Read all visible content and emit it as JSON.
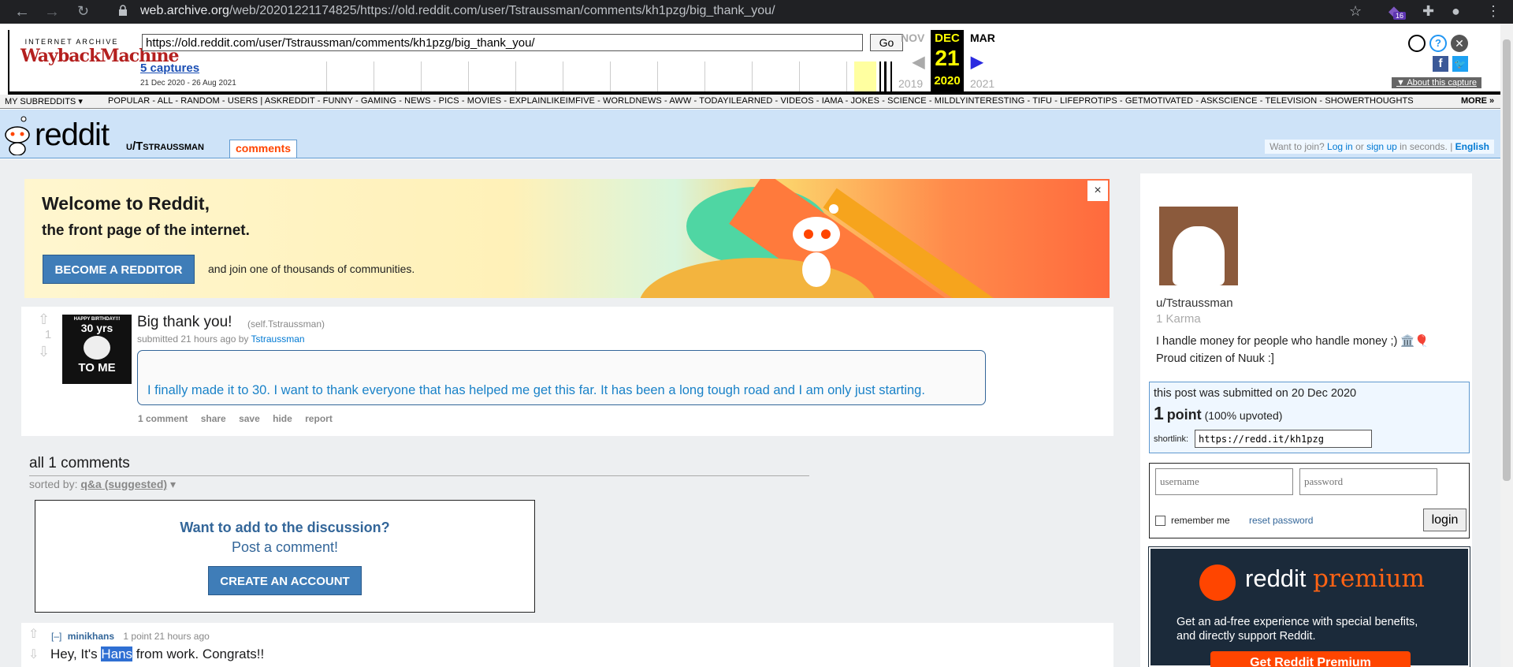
{
  "browser": {
    "url_domain": "web.archive.org",
    "url_path": "/web/20201221174825/https://old.reddit.com/user/Tstraussman/comments/kh1pzg/big_thank_you/",
    "extension_badge": "16"
  },
  "wayback": {
    "logo_top": "INTERNET ARCHIVE",
    "logo_main": "WaybackMachine",
    "url_value": "https://old.reddit.com/user/Tstraussman/comments/kh1pzg/big_thank_you/",
    "go_label": "Go",
    "captures_label": "5 captures",
    "range_label": "21 Dec 2020 - 26 Aug 2021",
    "prev_month": "NOV",
    "prev_year": "2019",
    "cur_month": "DEC",
    "cur_day": "21",
    "cur_year": "2020",
    "next_month": "MAR",
    "next_year": "2021",
    "about_label": "About this capture"
  },
  "srbar": {
    "my_subreddits": "MY SUBREDDITS",
    "items": "POPULAR - ALL - RANDOM - USERS | ASKREDDIT - FUNNY - GAMING - NEWS - PICS - MOVIES - EXPLAINLIKEIMFIVE - WORLDNEWS - AWW - TODAYILEARNED - VIDEOS - IAMA - JOKES - SCIENCE - MILDLYINTERESTING - TIFU - LIFEPROTIPS - GETMOTIVATED - ASKSCIENCE - TELEVISION - SHOWERTHOUGHTS",
    "more": "MORE »"
  },
  "header": {
    "wordmark": "reddit",
    "user": "u/Tstraussman",
    "tab": "comments",
    "join_prefix": "Want to join?",
    "login": "Log in",
    "or": "or",
    "signup": "sign up",
    "in_seconds": "in seconds.",
    "sep": "|",
    "language": "English"
  },
  "banner": {
    "title": "Welcome to Reddit,",
    "subtitle": "the front page of the internet.",
    "button": "BECOME A REDDITOR",
    "join_text": "and join one of thousands of communities.",
    "close": "×"
  },
  "post": {
    "score": "1",
    "thumb_line1": "HAPPY BIRTHDAY!!!",
    "thumb_line2": "30 yrs",
    "thumb_line3": "TO ME",
    "title": "Big thank you!",
    "domain": "(self.Tstraussman)",
    "submitted": "submitted 21 hours ago by",
    "author": "Tstraussman",
    "body": "I finally made it to 30. I want to thank everyone that has helped me get this far. It has been a long tough road and I am only just starting.",
    "actions": [
      "1 comment",
      "share",
      "save",
      "hide",
      "report"
    ]
  },
  "comments": {
    "header": "all 1 comments",
    "sorted_by": "sorted by:",
    "sort_value": "q&a (suggested)",
    "prompt_q": "Want to add to the discussion?",
    "prompt_p": "Post a comment!",
    "create_btn": "CREATE AN ACCOUNT",
    "items": [
      {
        "collapse": "[–]",
        "author": "minikhans",
        "meta": "1 point 21 hours ago",
        "body_pre": "Hey, It's ",
        "body_hl": "Hans",
        "body_post": " from work. Congrats!!"
      }
    ]
  },
  "sidebar": {
    "username": "u/Tstraussman",
    "karma": "1 Karma",
    "bio_line1": "I handle money for people who handle money ;) 🏛️🎈",
    "bio_line2": "Proud citizen of Nuuk :]",
    "stats_line": "this post was submitted on 20 Dec 2020",
    "points_num": "1",
    "points_word": "point",
    "upvoted": "(100% upvoted)",
    "shortlink_label": "shortlink:",
    "shortlink": "https://redd.it/kh1pzg",
    "username_placeholder": "username",
    "password_placeholder": "password",
    "remember": "remember me",
    "reset": "reset password",
    "login": "login",
    "premium_brand": "reddit",
    "premium_word": "premium",
    "premium_desc_1": "Get an ad-free experience with special benefits,",
    "premium_desc_2": "and directly support Reddit.",
    "premium_btn": "Get Reddit Premium"
  },
  "colors": {
    "reddit_orange": "#ff4500",
    "header_blue": "#cee3f8",
    "link_blue": "#0079d3"
  }
}
